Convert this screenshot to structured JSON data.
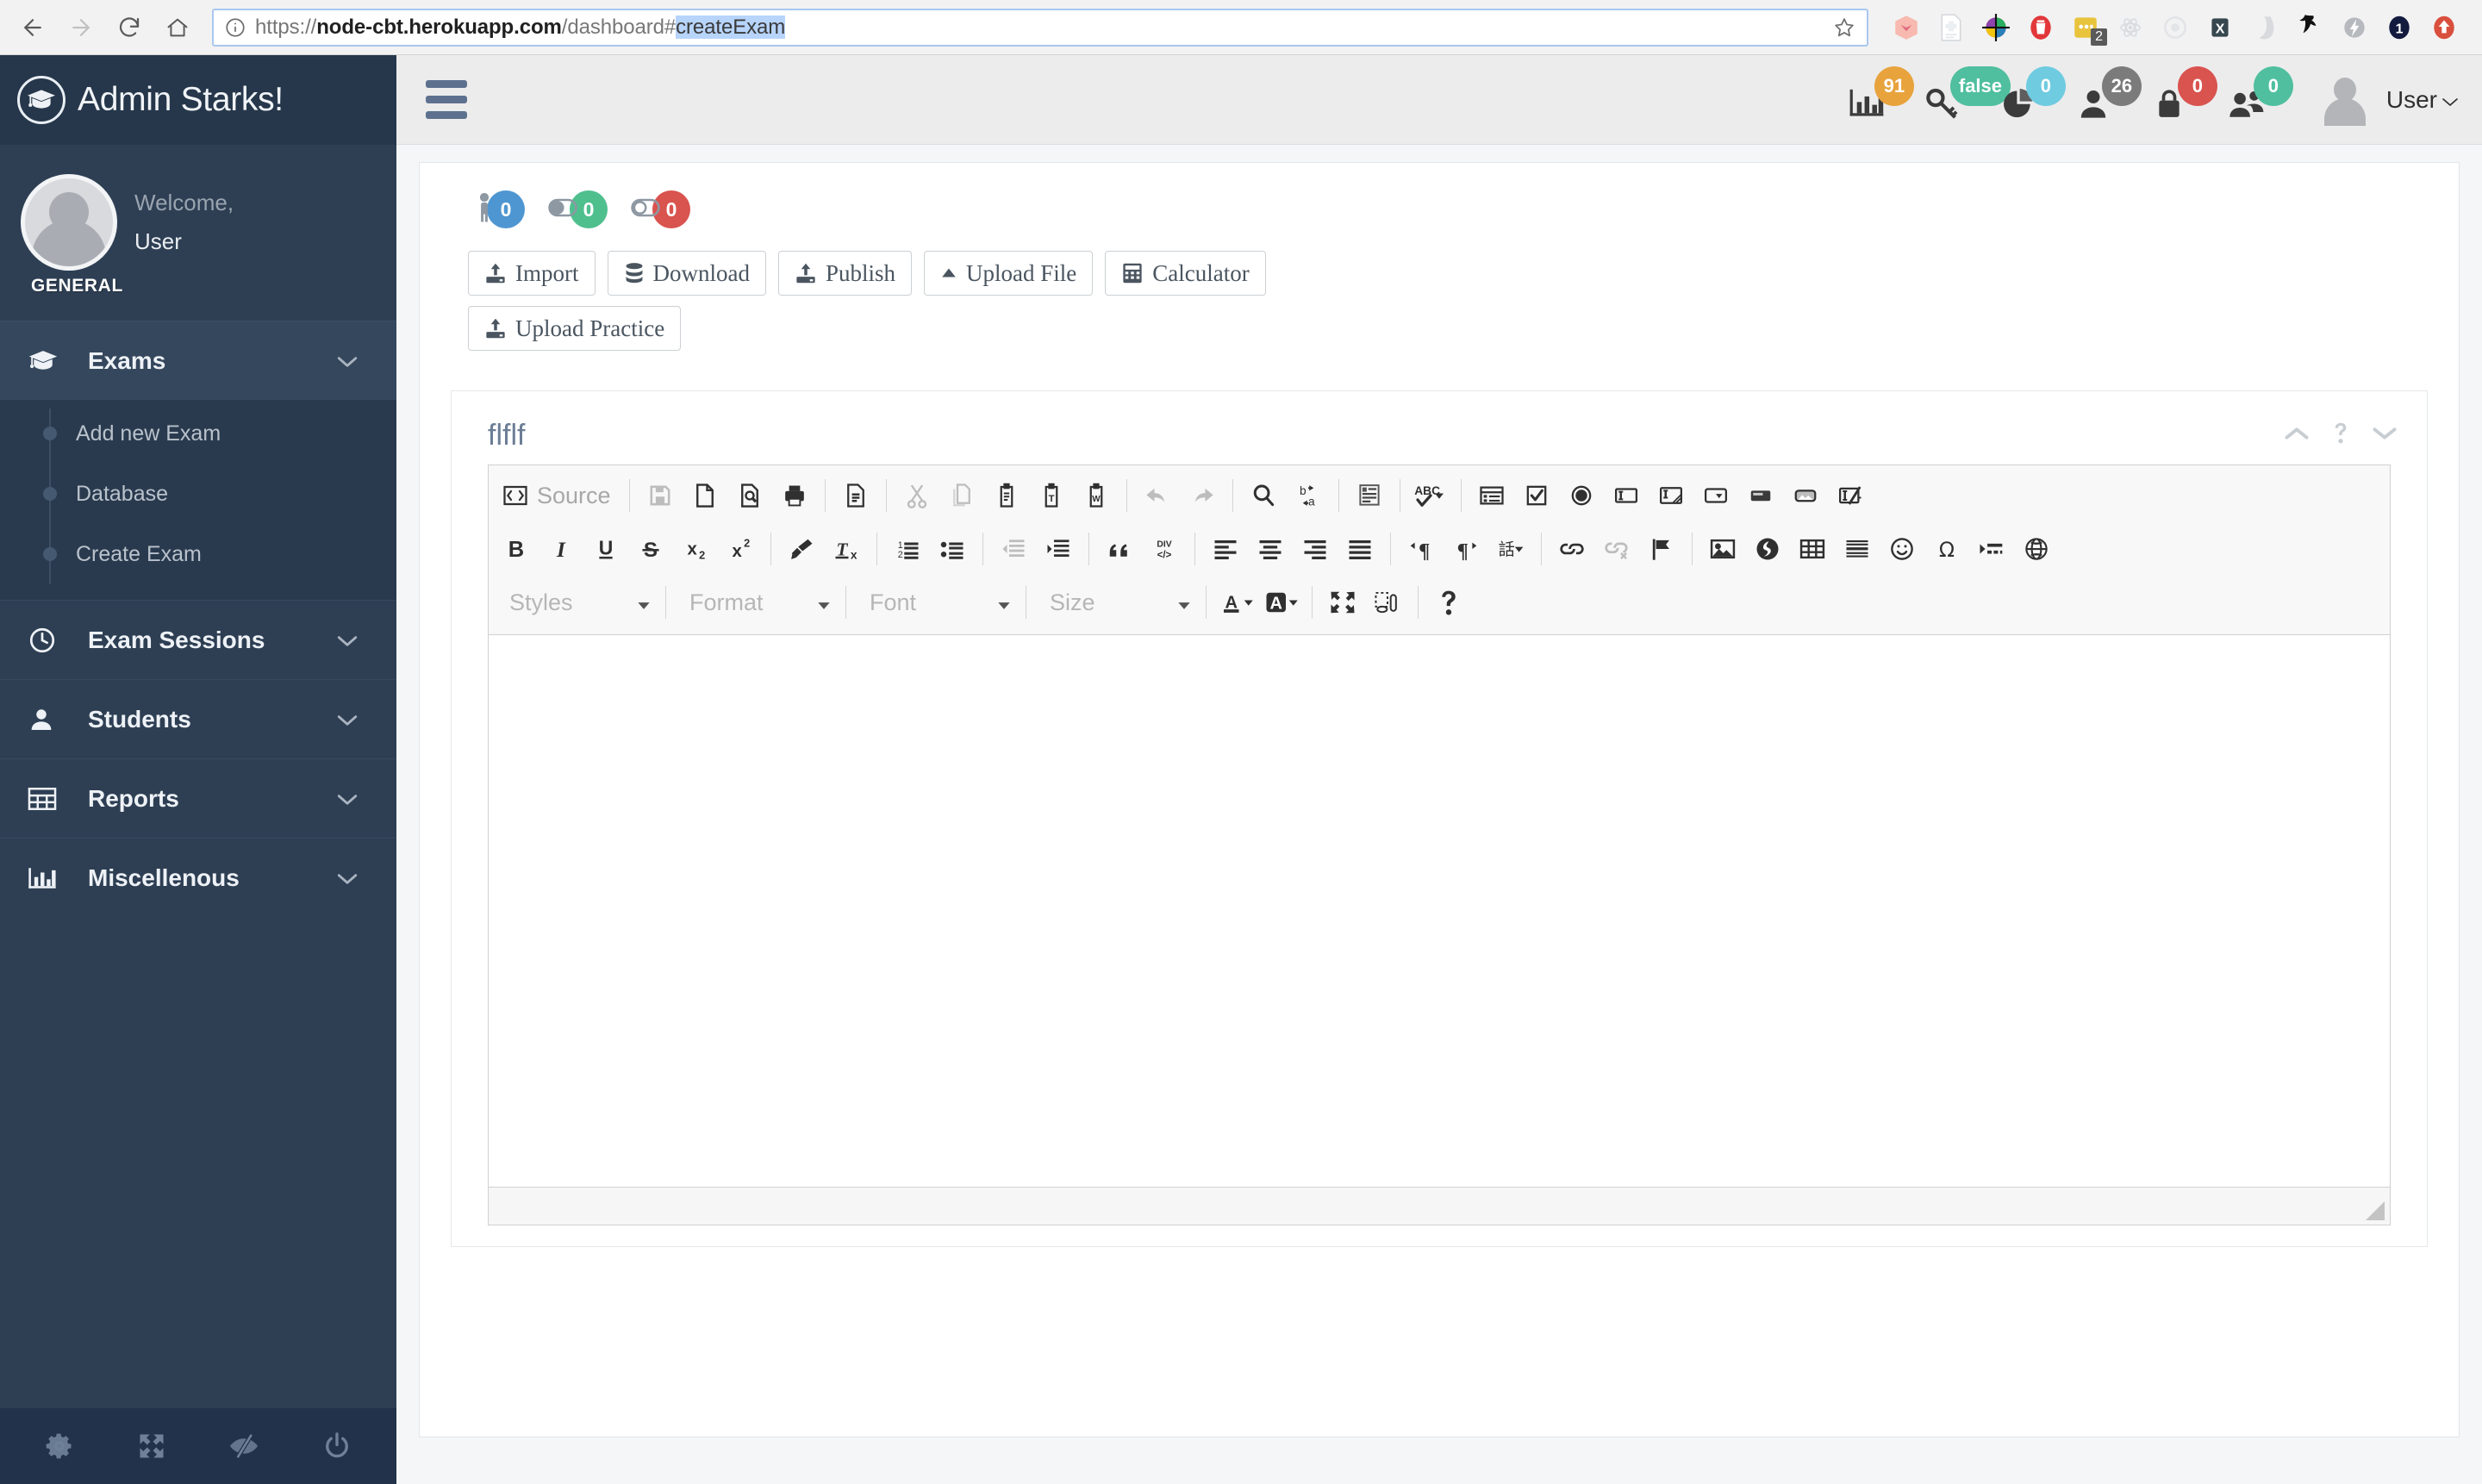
{
  "browser": {
    "nav": [
      {
        "name": "back-button",
        "icon": "arrow-left-icon",
        "enabled": true
      },
      {
        "name": "forward-button",
        "icon": "arrow-right-icon",
        "enabled": false
      },
      {
        "name": "reload-button",
        "icon": "reload-icon",
        "enabled": true
      },
      {
        "name": "home-button",
        "icon": "home-icon",
        "enabled": true
      }
    ],
    "url": {
      "scheme": "https://",
      "host": "node-cbt.herokuapp.com",
      "path": "/dashboard#",
      "selected": "createExam",
      "full": "https://node-cbt.herokuapp.com/dashboard#createExam"
    },
    "info_icon": "info-circle-icon",
    "bookmark_icon": "star-icon",
    "extensions": [
      {
        "name": "momentum-icon",
        "badge": ""
      },
      {
        "name": "document-plus-icon",
        "badge": ""
      },
      {
        "name": "color-wheel-icon",
        "badge": ""
      },
      {
        "name": "trash-red-icon",
        "badge": ""
      },
      {
        "name": "yellow-notes-icon",
        "badge": "2"
      },
      {
        "name": "react-devtools-icon",
        "badge": ""
      },
      {
        "name": "circle-gray-icon",
        "badge": ""
      },
      {
        "name": "x-letter-icon",
        "badge": ""
      },
      {
        "name": "ghost-gray-icon",
        "badge": ""
      },
      {
        "name": "black-figure-icon",
        "badge": ""
      },
      {
        "name": "lightning-gray-icon",
        "badge": ""
      },
      {
        "name": "dark-one-badge-icon",
        "badge": ""
      },
      {
        "name": "red-up-arrow-icon",
        "badge": ""
      }
    ]
  },
  "sidebar": {
    "brand": "Admin Starks!",
    "brand_icon": "graduation-cap-icon",
    "welcome_line1": "Welcome,",
    "welcome_line2": "User",
    "section_label": "GENERAL",
    "accent_color": "#5ec2a0",
    "nav": [
      {
        "label": "Exams",
        "icon": "graduation-cap-icon",
        "active": true,
        "expanded": true,
        "children": [
          "Add new Exam",
          "Database",
          "Create Exam"
        ]
      },
      {
        "label": "Exam Sessions",
        "icon": "clock-icon",
        "active": false,
        "expanded": false,
        "children": []
      },
      {
        "label": "Students",
        "icon": "user-icon",
        "active": false,
        "expanded": false,
        "children": []
      },
      {
        "label": "Reports",
        "icon": "table-icon",
        "active": false,
        "expanded": false,
        "children": []
      },
      {
        "label": "Miscellenous",
        "icon": "bar-chart-icon",
        "active": false,
        "expanded": false,
        "children": []
      }
    ],
    "footer_icons": [
      "gear-icon",
      "expand-arrows-icon",
      "eye-slash-icon",
      "power-icon"
    ]
  },
  "topbar": {
    "menu_toggle_icon": "hamburger-icon",
    "badges": [
      {
        "icon": "bar-chart-icon",
        "value": "91",
        "color": "#e8a33d"
      },
      {
        "icon": "key-icon",
        "value": "false",
        "color": "#4fbf9f"
      },
      {
        "icon": "pie-chart-icon",
        "value": "0",
        "color": "#6fcbe0"
      },
      {
        "icon": "user-icon",
        "value": "26",
        "color": "#7b7b7b"
      },
      {
        "icon": "lock-icon",
        "value": "0",
        "color": "#d9534f"
      },
      {
        "icon": "users-icon",
        "value": "0",
        "color": "#4fbf9f"
      }
    ],
    "avatar_icon": "user-avatar-icon",
    "user_label": "User",
    "user_caret_icon": "chevron-down-icon"
  },
  "counters": [
    {
      "icon": "person-icon",
      "value": "0",
      "color": "#4e96d1"
    },
    {
      "icon": "toggle-on-icon",
      "value": "0",
      "color": "#4fbf8e"
    },
    {
      "icon": "toggle-off-icon",
      "value": "0",
      "color": "#d9534f"
    }
  ],
  "action_buttons": {
    "row1": [
      {
        "label": "Import",
        "icon": "upload-icon"
      },
      {
        "label": "Download",
        "icon": "database-icon"
      },
      {
        "label": "Publish",
        "icon": "upload-icon"
      },
      {
        "label": "Upload File",
        "icon": "caret-up-icon"
      },
      {
        "label": "Calculator",
        "icon": "calculator-icon"
      }
    ],
    "row2": [
      {
        "label": "Upload Practice",
        "icon": "upload-icon"
      }
    ]
  },
  "editor": {
    "title": "flflf",
    "head_tools": [
      "chevron-up-icon",
      "question-mark-icon",
      "chevron-down-icon"
    ],
    "source_label": "Source",
    "toolbar_row1": [
      {
        "name": "source-button",
        "icon": "code-brackets-icon",
        "dim": false
      },
      {
        "sep": true
      },
      {
        "name": "save-button",
        "icon": "floppy-disk-icon",
        "dim": true
      },
      {
        "name": "new-page-button",
        "icon": "page-icon",
        "dim": false
      },
      {
        "name": "preview-button",
        "icon": "page-search-icon",
        "dim": false
      },
      {
        "name": "print-button",
        "icon": "printer-icon",
        "dim": false
      },
      {
        "sep": true
      },
      {
        "name": "templates-button",
        "icon": "document-lines-icon",
        "dim": false
      },
      {
        "sep": true
      },
      {
        "name": "cut-button",
        "icon": "scissors-icon",
        "dim": true
      },
      {
        "name": "copy-button",
        "icon": "copy-icon",
        "dim": true
      },
      {
        "name": "paste-button",
        "icon": "clipboard-icon",
        "dim": false
      },
      {
        "name": "paste-text-button",
        "icon": "clipboard-text-icon",
        "dim": false
      },
      {
        "name": "paste-word-button",
        "icon": "clipboard-word-icon",
        "dim": false
      },
      {
        "sep": true
      },
      {
        "name": "undo-button",
        "icon": "undo-arrow-icon",
        "dim": true
      },
      {
        "name": "redo-button",
        "icon": "redo-arrow-icon",
        "dim": true
      },
      {
        "sep": true
      },
      {
        "name": "find-button",
        "icon": "magnifier-icon",
        "dim": false
      },
      {
        "name": "replace-button",
        "icon": "replace-ba-icon",
        "dim": false
      },
      {
        "sep": true
      },
      {
        "name": "select-all-button",
        "icon": "select-all-icon",
        "dim": false
      },
      {
        "sep": true
      },
      {
        "name": "spellcheck-button",
        "icon": "abc-check-icon",
        "dim": false
      },
      {
        "sep": true
      },
      {
        "name": "form-button",
        "icon": "form-icon",
        "dim": false
      },
      {
        "name": "checkbox-button",
        "icon": "checkbox-icon",
        "dim": false
      },
      {
        "name": "radio-button",
        "icon": "radio-icon",
        "dim": false
      },
      {
        "name": "text-field-button",
        "icon": "text-field-icon",
        "dim": false
      },
      {
        "name": "textarea-button",
        "icon": "textarea-icon",
        "dim": false
      },
      {
        "name": "select-field-button",
        "icon": "select-field-icon",
        "dim": false
      },
      {
        "name": "button-field-button",
        "icon": "button-field-icon",
        "dim": false
      },
      {
        "name": "image-button-button",
        "icon": "image-button-icon",
        "dim": false
      },
      {
        "name": "hidden-field-button",
        "icon": "hidden-field-icon",
        "dim": false
      }
    ],
    "toolbar_row2": [
      {
        "name": "bold-button",
        "icon": "bold-icon"
      },
      {
        "name": "italic-button",
        "icon": "italic-icon"
      },
      {
        "name": "underline-button",
        "icon": "underline-icon"
      },
      {
        "name": "strike-button",
        "icon": "strikethrough-icon"
      },
      {
        "name": "subscript-button",
        "icon": "subscript-icon"
      },
      {
        "name": "superscript-button",
        "icon": "superscript-icon"
      },
      {
        "sep": true
      },
      {
        "name": "copy-formatting-button",
        "icon": "paintbrush-icon"
      },
      {
        "name": "remove-format-button",
        "icon": "remove-format-icon"
      },
      {
        "sep": true
      },
      {
        "name": "numbered-list-button",
        "icon": "numbered-list-icon"
      },
      {
        "name": "bulleted-list-button",
        "icon": "bulleted-list-icon"
      },
      {
        "sep": true
      },
      {
        "name": "outdent-button",
        "icon": "outdent-icon",
        "dim": true
      },
      {
        "name": "indent-button",
        "icon": "indent-icon"
      },
      {
        "sep": true
      },
      {
        "name": "blockquote-button",
        "icon": "quote-icon"
      },
      {
        "name": "div-button",
        "icon": "div-container-icon"
      },
      {
        "sep": true
      },
      {
        "name": "align-left-button",
        "icon": "align-left-icon"
      },
      {
        "name": "align-center-button",
        "icon": "align-center-icon"
      },
      {
        "name": "align-right-button",
        "icon": "align-right-icon"
      },
      {
        "name": "align-justify-button",
        "icon": "align-justify-icon"
      },
      {
        "sep": true
      },
      {
        "name": "ltr-button",
        "icon": "text-ltr-icon"
      },
      {
        "name": "rtl-button",
        "icon": "text-rtl-icon"
      },
      {
        "name": "language-button",
        "icon": "language-icon"
      },
      {
        "sep": true
      },
      {
        "name": "link-button",
        "icon": "link-icon"
      },
      {
        "name": "unlink-button",
        "icon": "unlink-icon",
        "dim": true
      },
      {
        "name": "anchor-button",
        "icon": "flag-icon"
      },
      {
        "sep": true
      },
      {
        "name": "image-button",
        "icon": "image-icon"
      },
      {
        "name": "flash-button",
        "icon": "flash-icon"
      },
      {
        "name": "table-button",
        "icon": "table-icon"
      },
      {
        "name": "horizontal-rule-button",
        "icon": "horizontal-rule-icon"
      },
      {
        "name": "smiley-button",
        "icon": "smiley-icon"
      },
      {
        "name": "special-char-button",
        "icon": "omega-icon"
      },
      {
        "name": "page-break-button",
        "icon": "page-break-icon"
      },
      {
        "name": "iframe-button",
        "icon": "globe-icon"
      }
    ],
    "toolbar_row3": {
      "combos": [
        {
          "name": "styles-combo",
          "label": "Styles"
        },
        {
          "name": "format-combo",
          "label": "Format"
        },
        {
          "name": "font-combo",
          "label": "Font"
        },
        {
          "name": "size-combo",
          "label": "Size"
        }
      ],
      "buttons": [
        {
          "name": "text-color-button",
          "icon": "text-color-a-icon"
        },
        {
          "name": "background-color-button",
          "icon": "bg-color-a-icon"
        },
        {
          "name": "maximize-button",
          "icon": "maximize-icon"
        },
        {
          "name": "show-blocks-button",
          "icon": "show-blocks-icon"
        },
        {
          "name": "about-button",
          "icon": "question-mark-icon"
        }
      ]
    },
    "body_text": "",
    "resize_handle_icon": "resize-handle-icon"
  }
}
